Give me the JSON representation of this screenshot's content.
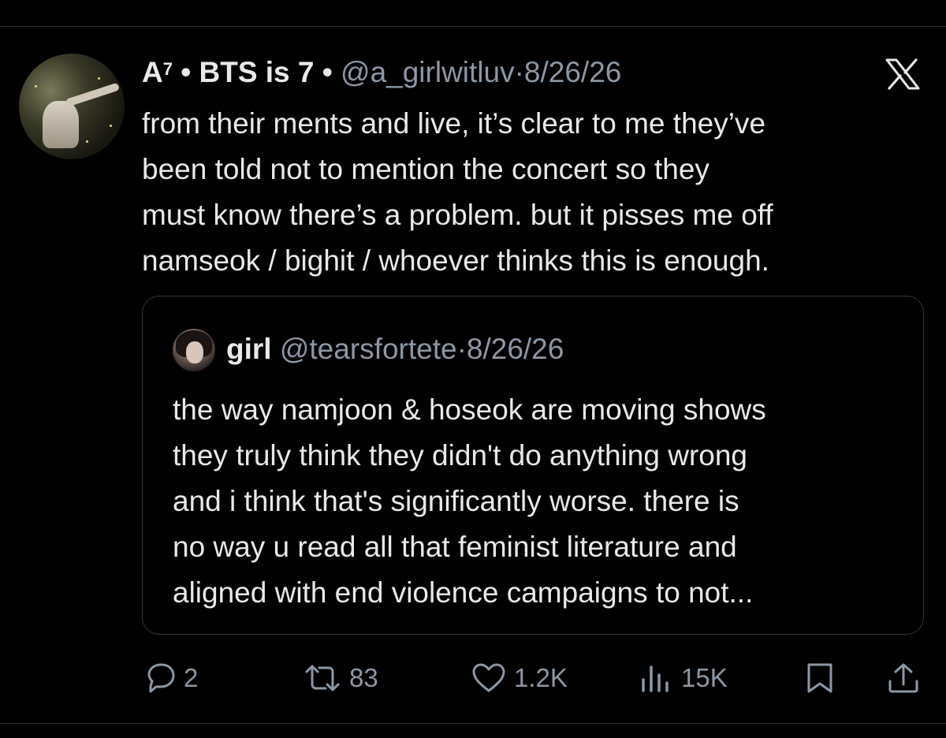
{
  "tweet": {
    "author_name": "A",
    "author_superscript": "7",
    "author_name_rest": " • BTS is 7 •",
    "handle": "@a_girlwitluv",
    "separator": "·",
    "date": "8/26/26",
    "lines": [
      "from their ments and live, it’s clear to me they’ve",
      "been told not to mention the concert so they",
      "must know there’s a problem. but it pisses me off",
      "namseok / bighit / whoever thinks this is enough."
    ]
  },
  "quote": {
    "name": "girl",
    "handle": "@tearsfortete",
    "separator": "·",
    "date": "8/26/26",
    "lines": [
      "the way namjoon & hoseok are moving shows",
      "they truly think they didn't do anything wrong",
      "and i think that's significantly worse. there is",
      "no way u read all that feminist literature and",
      "aligned with end violence campaigns to not..."
    ]
  },
  "actions": {
    "replies": "2",
    "retweets": "83",
    "likes": "1.2K",
    "views": "15K"
  },
  "icons": {
    "platform_logo": "x-logo-icon",
    "reply": "reply-icon",
    "retweet": "retweet-icon",
    "like": "heart-icon",
    "views": "views-icon",
    "bookmark": "bookmark-icon",
    "share": "share-icon"
  },
  "colors": {
    "background": "#000000",
    "text": "#e7e9ea",
    "muted": "#8b98a5",
    "border": "#333639"
  }
}
